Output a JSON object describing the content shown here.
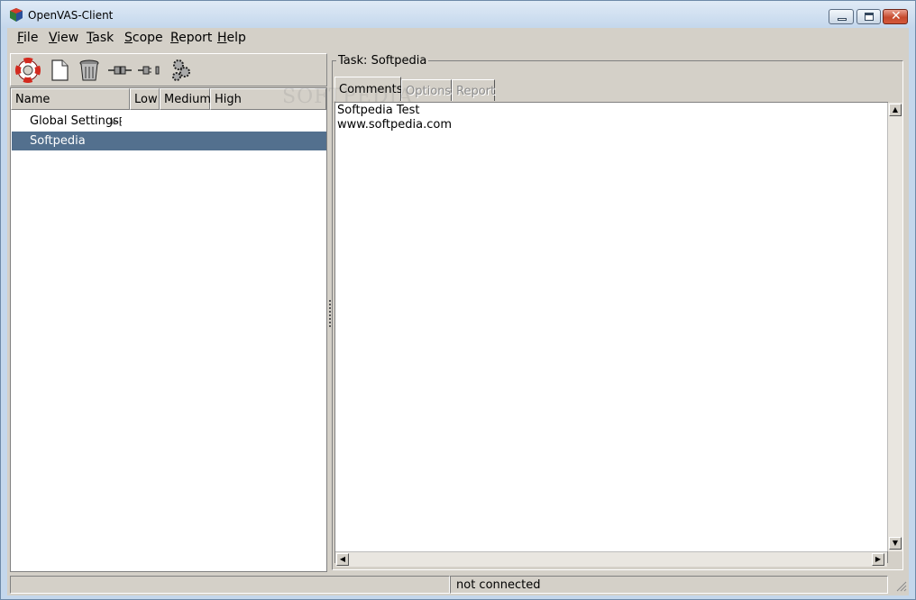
{
  "window": {
    "title": "OpenVAS-Client"
  },
  "menubar": {
    "items": [
      {
        "key": "F",
        "rest": "ile"
      },
      {
        "key": "V",
        "rest": "iew"
      },
      {
        "key": "T",
        "rest": "ask"
      },
      {
        "key": "S",
        "rest": "cope"
      },
      {
        "key": "R",
        "rest": "eport"
      },
      {
        "key": "H",
        "rest": "elp"
      }
    ]
  },
  "toolbar": {
    "buttons": [
      {
        "icon": "lifebuoy-icon"
      },
      {
        "icon": "new-document-icon"
      },
      {
        "icon": "trash-icon"
      },
      {
        "icon": "connect-plug-icon"
      },
      {
        "icon": "disconnect-plug-icon"
      },
      {
        "icon": "scan-gears-icon"
      }
    ]
  },
  "tree": {
    "columns": [
      "Name",
      "Low",
      "Medium",
      "High"
    ],
    "rows": [
      {
        "label": "Global Settings",
        "selected": false
      },
      {
        "label": "Softpedia",
        "selected": true
      }
    ]
  },
  "task": {
    "frame_label": "Task: Softpedia",
    "tabs": [
      {
        "label": "Comments",
        "active": true,
        "enabled": true
      },
      {
        "label": "Options",
        "active": false,
        "enabled": false
      },
      {
        "label": "Report",
        "active": false,
        "enabled": false
      }
    ],
    "comments": [
      "Softpedia Test",
      "www.softpedia.com"
    ]
  },
  "status": {
    "text": "not connected"
  },
  "watermark": "SOFTPEDIA",
  "colors": {
    "selection": "#53708e",
    "dialog": "#d4d0c8"
  }
}
